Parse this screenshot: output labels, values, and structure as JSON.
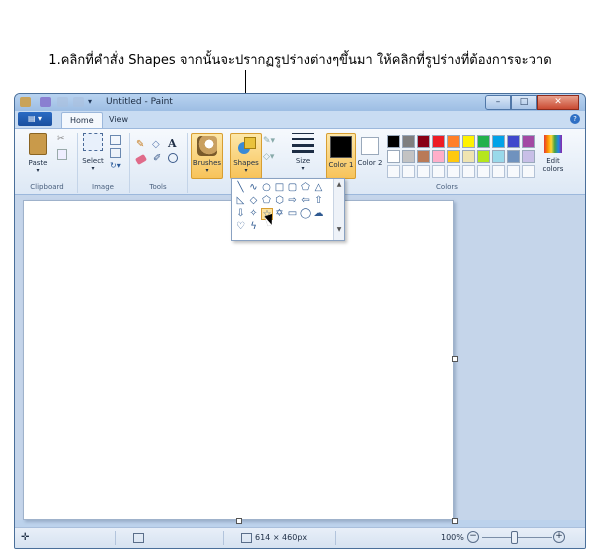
{
  "instruction": "1.คลิกที่คำสั่ง Shapes จากนั้นจะปรากฏรูปร่างต่างๆขึ้นมา ให้คลิกที่รูปร่างที่ต้องการจะวาด",
  "window": {
    "title": "Untitled - Paint",
    "min_glyph": "–",
    "max_glyph": "□",
    "close_glyph": "✕",
    "help_glyph": "?"
  },
  "tabs": {
    "app_menu": "▤ ▾",
    "home": "Home",
    "view": "View"
  },
  "ribbon": {
    "paste": "Paste",
    "select": "Select",
    "brushes": "Brushes",
    "shapes": "Shapes",
    "size": "Size",
    "color1": "Color 1",
    "color2": "Color 2",
    "edit_colors": "Edit colors",
    "groups": {
      "clipboard": "Clipboard",
      "image": "Image",
      "tools": "Tools",
      "colors": "Colors"
    }
  },
  "palette_colors": [
    "#000000",
    "#7f7f7f",
    "#880015",
    "#ed1c24",
    "#ff7f27",
    "#fff200",
    "#22b14c",
    "#00a2e8",
    "#3f48cc",
    "#a349a4",
    "#ffffff",
    "#c3c3c3",
    "#b97a57",
    "#ffaec9",
    "#ffc90e",
    "#efe4b0",
    "#b5e61d",
    "#99d9ea",
    "#7092be",
    "#c8bfe7"
  ],
  "color1_value": "#000000",
  "color2_value": "#ffffff",
  "status": {
    "dimensions": "614 × 460px",
    "zoom": "100%",
    "zoom_level": 1.0
  }
}
